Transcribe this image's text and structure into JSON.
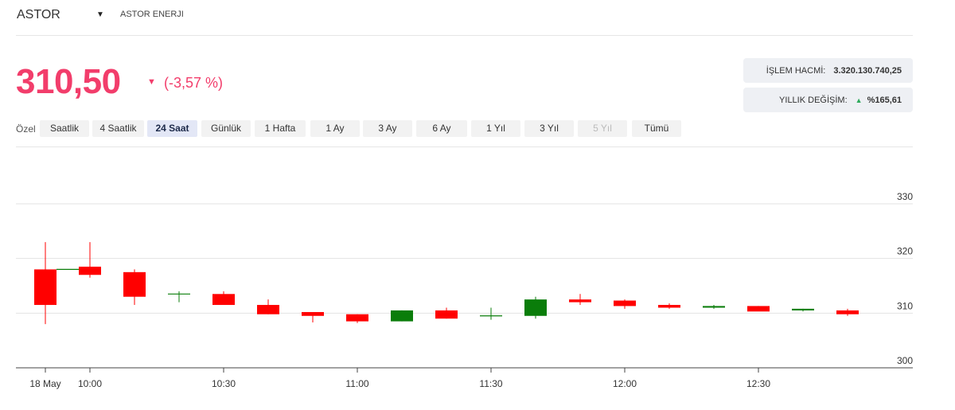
{
  "header": {
    "ticker": "ASTOR",
    "company": "ASTOR ENERJI"
  },
  "quote": {
    "price": "310,50",
    "change": "(-3,57 %)"
  },
  "stats": {
    "volume_label": "İŞLEM HACMİ:",
    "volume_value": "3.320.130.740,25",
    "yoy_label": "YILLIK DEĞİŞİM:",
    "yoy_value": "%165,61"
  },
  "range": {
    "label": "Özel",
    "options": [
      "Saatlik",
      "4 Saatlik",
      "24 Saat",
      "Günlük",
      "1 Hafta",
      "1 Ay",
      "3 Ay",
      "6 Ay",
      "1 Yıl",
      "3 Yıl",
      "5 Yıl",
      "Tümü"
    ],
    "active": "24 Saat",
    "disabled": [
      "5 Yıl"
    ]
  },
  "colors": {
    "up": "#0a7d0a",
    "down": "#ff0000",
    "accent": "#f23d6b"
  },
  "chart_data": {
    "type": "candlestick",
    "ylim": [
      300,
      330
    ],
    "y_ticks": [
      300,
      310,
      320,
      330
    ],
    "x_ticks": [
      "18 May",
      "10:00",
      "10:30",
      "11:00",
      "11:30",
      "12:00",
      "12:30"
    ],
    "x_tick_times": [
      "09:50",
      "10:00",
      "10:30",
      "11:00",
      "11:30",
      "12:00",
      "12:30"
    ],
    "candles": [
      {
        "t": "09:50",
        "open": 318.0,
        "high": 323.0,
        "low": 308.0,
        "close": 311.5
      },
      {
        "t": "09:55",
        "open": 318.0,
        "high": 318.0,
        "low": 318.0,
        "close": 318.0
      },
      {
        "t": "10:00",
        "open": 318.5,
        "high": 323.0,
        "low": 316.5,
        "close": 317.0
      },
      {
        "t": "10:10",
        "open": 317.5,
        "high": 318.0,
        "low": 311.5,
        "close": 313.0
      },
      {
        "t": "10:20",
        "open": 313.5,
        "high": 314.0,
        "low": 312.0,
        "close": 313.5
      },
      {
        "t": "10:30",
        "open": 313.5,
        "high": 314.0,
        "low": 311.5,
        "close": 311.5
      },
      {
        "t": "10:40",
        "open": 311.5,
        "high": 312.5,
        "low": 309.8,
        "close": 309.8
      },
      {
        "t": "10:50",
        "open": 310.2,
        "high": 310.2,
        "low": 308.3,
        "close": 309.5
      },
      {
        "t": "11:00",
        "open": 309.8,
        "high": 309.8,
        "low": 308.2,
        "close": 308.5
      },
      {
        "t": "11:10",
        "open": 308.5,
        "high": 310.5,
        "low": 308.5,
        "close": 310.5
      },
      {
        "t": "11:20",
        "open": 310.5,
        "high": 311.0,
        "low": 309.0,
        "close": 309.0
      },
      {
        "t": "11:30",
        "open": 309.5,
        "high": 311.0,
        "low": 308.8,
        "close": 309.5
      },
      {
        "t": "11:40",
        "open": 309.5,
        "high": 313.0,
        "low": 309.0,
        "close": 312.5
      },
      {
        "t": "11:50",
        "open": 312.5,
        "high": 313.5,
        "low": 311.5,
        "close": 312.0
      },
      {
        "t": "12:00",
        "open": 312.3,
        "high": 312.5,
        "low": 310.8,
        "close": 311.3
      },
      {
        "t": "12:10",
        "open": 311.5,
        "high": 311.8,
        "low": 310.8,
        "close": 311.0
      },
      {
        "t": "12:20",
        "open": 311.0,
        "high": 311.5,
        "low": 310.8,
        "close": 311.3
      },
      {
        "t": "12:30",
        "open": 311.3,
        "high": 311.3,
        "low": 310.5,
        "close": 310.3
      },
      {
        "t": "12:40",
        "open": 310.5,
        "high": 310.8,
        "low": 310.3,
        "close": 310.8
      },
      {
        "t": "12:50",
        "open": 310.5,
        "high": 310.8,
        "low": 309.5,
        "close": 309.8
      }
    ]
  }
}
